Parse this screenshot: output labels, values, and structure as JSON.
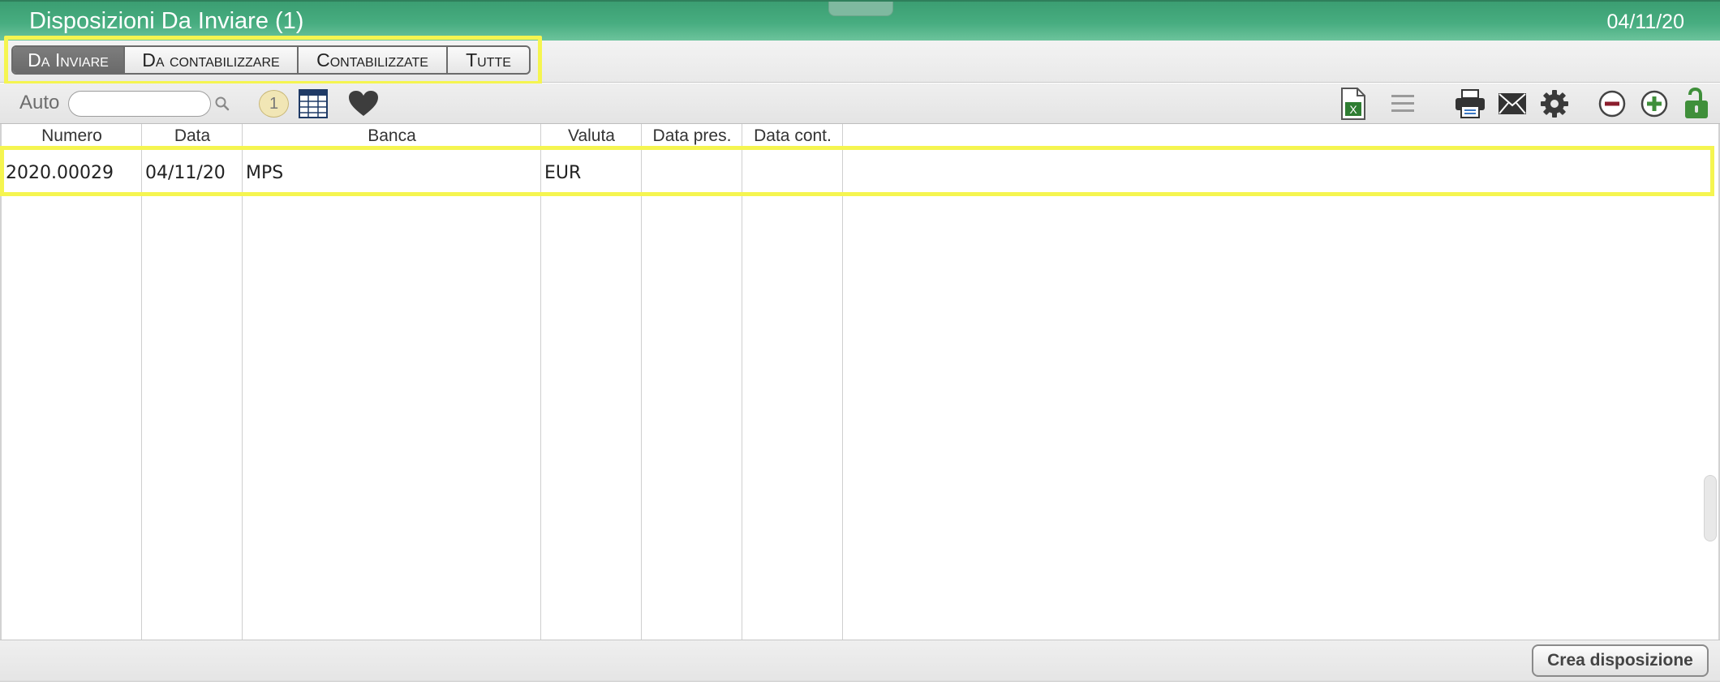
{
  "window": {
    "title": "Disposizioni Da Inviare (1)",
    "date": "04/11/20"
  },
  "tabs": [
    {
      "label": "Da Inviare",
      "active": true
    },
    {
      "label": "Da contabilizzare",
      "active": false
    },
    {
      "label": "Contabilizzate",
      "active": false
    },
    {
      "label": "Tutte",
      "active": false
    }
  ],
  "toolbar": {
    "auto_label": "Auto",
    "search_value": "",
    "count_badge": "1",
    "left_icons": [
      "search-icon",
      "table-grid-icon",
      "heart-icon"
    ],
    "right_icons": [
      "excel-export-icon",
      "list-menu-icon",
      "printer-icon",
      "mail-icon",
      "gear-icon",
      "remove-icon",
      "add-icon",
      "unlock-icon"
    ]
  },
  "table": {
    "columns": [
      "Numero",
      "Data",
      "Banca",
      "Valuta",
      "Data pres.",
      "Data cont."
    ],
    "rows": [
      [
        "2020.00029",
        "04/11/20",
        "MPS",
        "EUR",
        "",
        ""
      ]
    ]
  },
  "footer": {
    "create_button": "Crea disposizione"
  },
  "colors": {
    "titlebar": "#47ad80",
    "highlight": "#f5f550",
    "active_tab": "#747474",
    "excel_green": "#2e7d32",
    "remove_red": "#8b1e2d",
    "add_green": "#3f8f3a"
  }
}
